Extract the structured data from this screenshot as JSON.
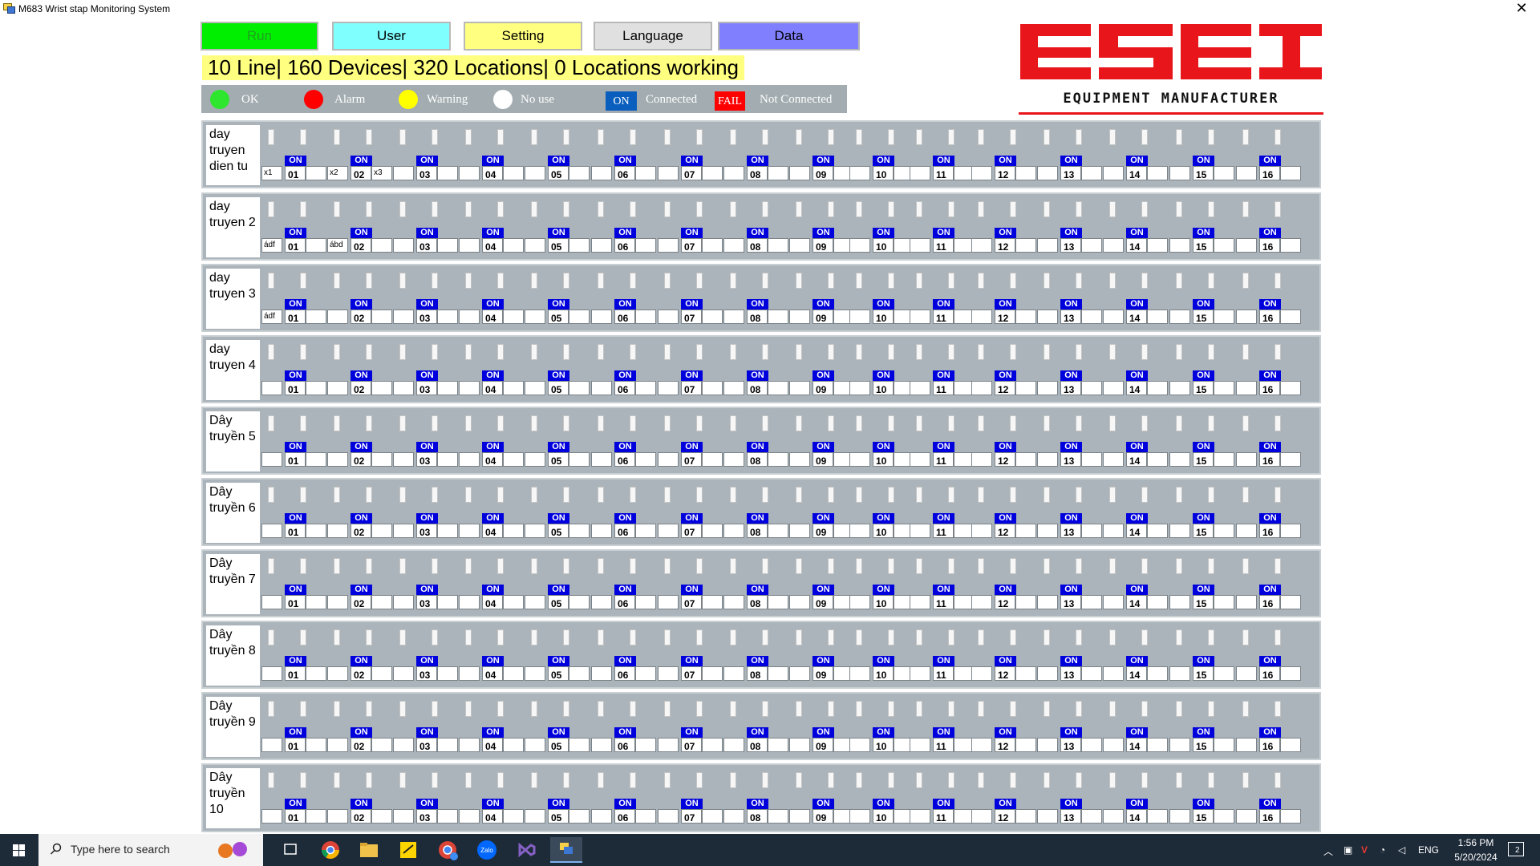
{
  "window": {
    "title": "M683 Wrist stap Monitoring System",
    "close": "✕"
  },
  "toolbar": {
    "run": "Run",
    "user": "User",
    "setting": "Setting",
    "language": "Language",
    "data": "Data"
  },
  "summary": "10 Line| 160 Devices| 320 Locations| 0 Locations working",
  "legend": {
    "ok": "OK",
    "alarm": "Alarm",
    "warning": "Warning",
    "no_use": "No use",
    "on": "ON",
    "connected": "Connected",
    "fail": "FAIL",
    "not_connected": "Not Connected"
  },
  "colors": {
    "ok": "#2ee62e",
    "alarm": "#ff0000",
    "warning": "#ffff00",
    "no_use": "#ffffff",
    "on_badge": "#0000dd",
    "panel": "#aab4ba",
    "logo_red": "#e8151b"
  },
  "logo": {
    "caption": "EQUIPMENT MANUFACTURER"
  },
  "device_badge": "ON",
  "device_numbers": [
    "01",
    "02",
    "03",
    "04",
    "05",
    "06",
    "07",
    "08",
    "09",
    "10",
    "11",
    "12",
    "13",
    "14",
    "15",
    "16"
  ],
  "lines": [
    {
      "name": "day truyen dien tu",
      "labels": [
        "x1",
        "",
        "x2",
        "x3"
      ]
    },
    {
      "name": "day truyen 2",
      "labels": [
        "ádf",
        "",
        "ábd",
        ""
      ]
    },
    {
      "name": "day truyen 3",
      "labels": [
        "ádf",
        "",
        "",
        ""
      ]
    },
    {
      "name": "day truyen 4",
      "labels": [
        "",
        "",
        "",
        ""
      ]
    },
    {
      "name": "Dây truyền 5",
      "labels": [
        "",
        "",
        "",
        ""
      ]
    },
    {
      "name": "Dây truyền 6",
      "labels": [
        "",
        "",
        "",
        ""
      ]
    },
    {
      "name": "Dây truyền 7",
      "labels": [
        "",
        "",
        "",
        ""
      ]
    },
    {
      "name": "Dây truyền 8",
      "labels": [
        "",
        "",
        "",
        ""
      ]
    },
    {
      "name": "Dây truyền 9",
      "labels": [
        "",
        "",
        "",
        ""
      ]
    },
    {
      "name": "Dây truyền 10",
      "labels": [
        "",
        "",
        "",
        ""
      ]
    }
  ],
  "taskbar": {
    "search_placeholder": "Type here to search",
    "language": "ENG",
    "time": "1:56 PM",
    "date": "5/20/2024",
    "notifications": "2"
  }
}
